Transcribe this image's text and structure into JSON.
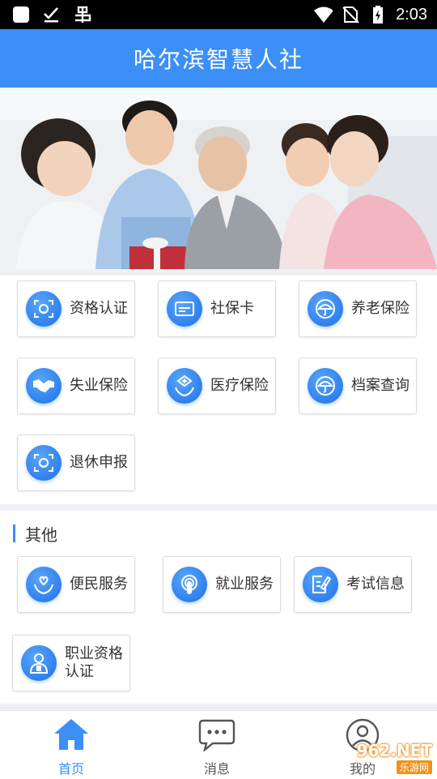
{
  "status_bar": {
    "time": "2:03",
    "left_icons": [
      "app-icon",
      "download-done-icon",
      "bug-icon"
    ],
    "right_icons": [
      "wifi-icon",
      "no-sim-icon",
      "battery-charging-icon"
    ]
  },
  "header": {
    "title": "哈尔滨智慧人社"
  },
  "banner": {
    "image": "family-photo"
  },
  "services": [
    {
      "label": "资格认证",
      "icon": "face-scan-icon"
    },
    {
      "label": "社保卡",
      "icon": "card-icon"
    },
    {
      "label": "养老保险",
      "icon": "umbrella-icon"
    },
    {
      "label": "失业保险",
      "icon": "handshake-icon"
    },
    {
      "label": "医疗保险",
      "icon": "medical-cross-icon"
    },
    {
      "label": "档案查询",
      "icon": "umbrella-icon"
    },
    {
      "label": "退休申报",
      "icon": "face-scan-icon"
    }
  ],
  "other": {
    "title": "其他",
    "items": [
      {
        "label": "便民服务",
        "icon": "heart-hands-icon"
      },
      {
        "label": "就业服务",
        "icon": "podcast-icon"
      },
      {
        "label": "考试信息",
        "icon": "edit-document-icon"
      },
      {
        "label": "职业资格认证",
        "icon": "person-badge-icon"
      }
    ]
  },
  "bottom_nav": {
    "items": [
      {
        "label": "首页",
        "icon": "home-icon",
        "active": true
      },
      {
        "label": "消息",
        "icon": "chat-bubble-icon",
        "active": false
      },
      {
        "label": "我的",
        "icon": "user-icon",
        "active": false
      }
    ]
  },
  "watermark": {
    "line1": "962.NET",
    "line2": "乐游网"
  },
  "colors": {
    "primary": "#3b8ff6",
    "background": "#eef0f3"
  }
}
